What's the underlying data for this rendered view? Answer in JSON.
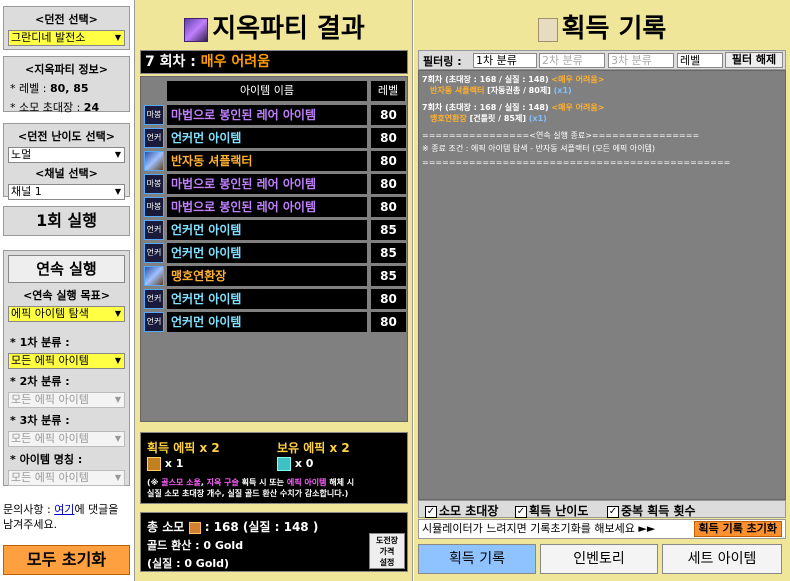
{
  "left": {
    "dungeon_title": "<던전 선택>",
    "dungeon_value": "그란디네 발전소",
    "info_title": "<지옥파티 정보>",
    "level_label": "* 레벨 : ",
    "level_value": "80, 85",
    "ticket_label": "* 소모 초대장 : ",
    "ticket_value": "24",
    "difficulty_title": "<던전 난이도 선택>",
    "difficulty_value": "노멀",
    "channel_title": "<채널 선택>",
    "channel_value": "채널 1",
    "run_once": "1회 실행",
    "cont_run": "연속 실행",
    "goal_title": "<연속 실행 목표>",
    "goal_value": "에픽 아이템 탐색",
    "tier1_label": "* 1차 분류 :",
    "tier1_value": "모든 에픽 아이템",
    "tier2_label": "* 2차 분류 :",
    "tier2_value": "모든 에픽 아이템",
    "tier3_label": "* 3차 분류 :",
    "tier3_value": "모든 에픽 아이템",
    "itemname_label": "* 아이템 명칭 :",
    "itemname_value": "모든 에픽 아이템",
    "contact_pre": "문의사항 : ",
    "contact_link": "여기",
    "contact_post": "에 댓글을",
    "contact_line2": "남겨주세요.",
    "reset_all": "모두 초기화"
  },
  "mid": {
    "title": "지옥파티 결과",
    "round": "7 회차 : ",
    "difficulty": "매우 어려움",
    "col_name": "아이템 이름",
    "col_level": "레벨",
    "items": [
      {
        "icon": "마봉",
        "name": "마법으로 봉인된 레어 아이템",
        "level": "80",
        "color": "#c080ff"
      },
      {
        "icon": "언커",
        "name": "언커먼 아이템",
        "level": "80",
        "color": "#80e0ff"
      },
      {
        "icon": "",
        "name": "반자동 셔플랙터",
        "level": "80",
        "color": "#ffb030"
      },
      {
        "icon": "마봉",
        "name": "마법으로 봉인된 레어 아이템",
        "level": "80",
        "color": "#c080ff"
      },
      {
        "icon": "마봉",
        "name": "마법으로 봉인된 레어 아이템",
        "level": "80",
        "color": "#c080ff"
      },
      {
        "icon": "언커",
        "name": "언커먼 아이템",
        "level": "85",
        "color": "#80e0ff"
      },
      {
        "icon": "언커",
        "name": "언커먼 아이템",
        "level": "85",
        "color": "#80e0ff"
      },
      {
        "icon": "",
        "name": "맹호연환장",
        "level": "85",
        "color": "#ffb030"
      },
      {
        "icon": "언커",
        "name": "언커먼 아이템",
        "level": "80",
        "color": "#80e0ff"
      },
      {
        "icon": "언커",
        "name": "언커먼 아이템",
        "level": "80",
        "color": "#80e0ff"
      }
    ],
    "epic_got": "획득 에픽 x 2",
    "epic_owned": "보유 에픽 x 2",
    "count1": "x 1",
    "count2": "x 0",
    "note_1": "(※ ",
    "note_a": "골스모 소울",
    "note_2": ", ",
    "note_b": "지옥 구슬",
    "note_3": " 획득 시 또는 ",
    "note_c": "에픽 아이템",
    "note_4": " 해체 시",
    "note_line2": "실질 소모 초대장 개수, 실질 골드 환산 수치가 감소합니다.)",
    "total_ticket": "총 소모",
    "total_ticket_value": ": 168 (실질 : 148 )",
    "gold_line1": "골드 환산 : 0 Gold",
    "gold_line2": "(실질 : 0 Gold)",
    "price_btn1": "도전장",
    "price_btn2": "가격",
    "price_btn3": "설정"
  },
  "right": {
    "title": "획득 기록",
    "filter_label": "필터링 :",
    "f1": "1차 분류",
    "f2": "2차 분류",
    "f3": "3차 분류",
    "f4": "레벨",
    "filter_reset": "필터 해제",
    "log": [
      {
        "head": "7회차 (초대장 : 168 / 실질 : 148) ",
        "diff": "<매우 어려움>",
        "item": "반자동 셔플랙터",
        "detail": " [자동권총 / 80제] ",
        "cnt": "(x1)"
      },
      {
        "head": "7회차 (초대장 : 168 / 실질 : 148) ",
        "diff": "<매우 어려움>",
        "item": "맹호연환장",
        "detail": " [건틀릿 / 85제] ",
        "cnt": "(x1)"
      }
    ],
    "sep1": "================<연속 실행 종료>================",
    "end_note": "※ 종료 조건 : 에픽 아이템 탐색 - 반자동 셔플랙터 (모든 에픽 아이템)",
    "sep2": "==============================================",
    "chk1": "소모 초대장",
    "chk2": "획득 난이도",
    "chk3": "중복 획득 횟수",
    "hint": "시뮬레이터가 느려지면 기록초기화를 해보세요 ►►",
    "hint_btn": "획득 기록 초기화",
    "tab1": "획득 기록",
    "tab2": "인벤토리",
    "tab3": "세트 아이템"
  }
}
